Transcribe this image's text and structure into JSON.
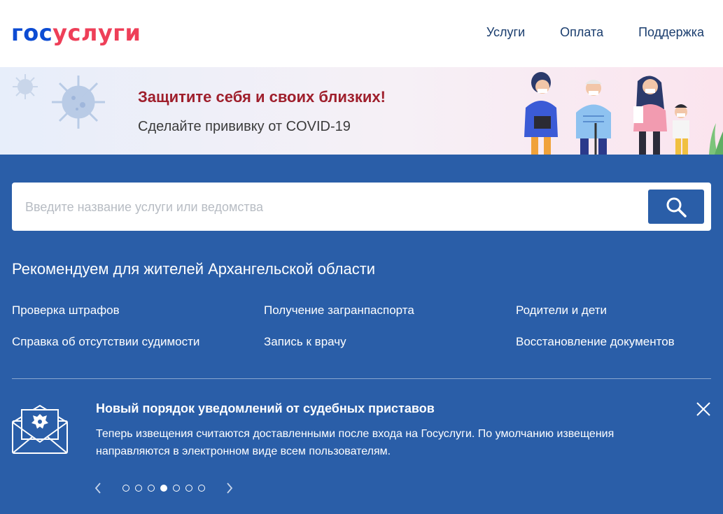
{
  "header": {
    "logo_part1": "гос",
    "logo_part2": "услуги",
    "nav": [
      "Услуги",
      "Оплата",
      "Поддержка"
    ]
  },
  "banner": {
    "title": "Защитите себя и своих близких!",
    "subtitle": "Сделайте прививку от COVID-19"
  },
  "search": {
    "placeholder": "Введите название услуги или ведомства",
    "button_icon": "search-icon"
  },
  "recommend": {
    "title": "Рекомендуем для жителей Архангельской области",
    "links": [
      "Проверка штрафов",
      "Получение загранпаспорта",
      "Родители и дети",
      "Справка об отсутствии судимости",
      "Запись к врачу",
      "Восстановление документов"
    ]
  },
  "notice": {
    "icon": "envelope-emblem-icon",
    "title": "Новый порядок уведомлений от судебных приставов",
    "text": "Теперь извещения считаются доставленными после входа на Госуслуги. По умолчанию извещения направляются в электронном виде всем пользователям.",
    "close_icon": "close-icon"
  },
  "pager": {
    "total": 7,
    "active_index": 3
  },
  "colors": {
    "brand_blue": "#2a5ea8",
    "logo_blue": "#0d4cd3",
    "logo_red": "#ee3f58",
    "banner_title": "#9f1f2c"
  }
}
